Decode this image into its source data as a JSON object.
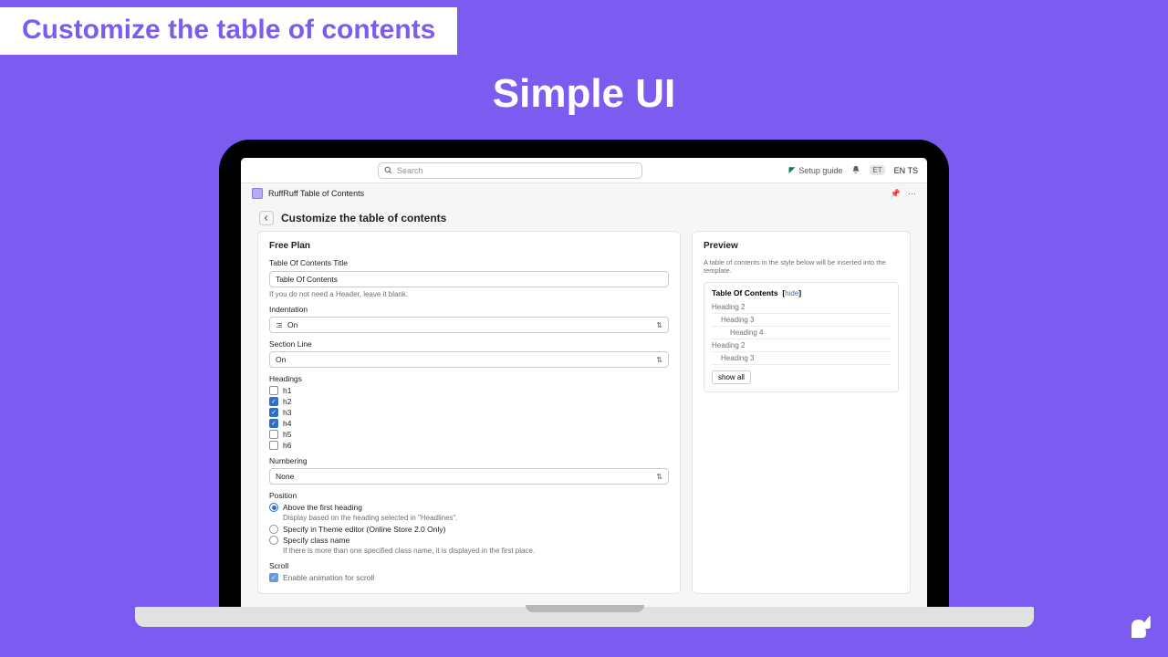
{
  "slide": {
    "banner": "Customize the table of contents",
    "title": "Simple UI"
  },
  "topbar": {
    "search_placeholder": "Search",
    "setup_guide": "Setup guide",
    "avatar_initials": "ET",
    "user_label": "EN TS"
  },
  "app": {
    "name": "RuffRuff Table of Contents",
    "pin_icon": "📌",
    "more_icon": "⋯"
  },
  "page": {
    "title": "Customize the table of contents"
  },
  "form": {
    "plan_heading": "Free Plan",
    "toc_title_label": "Table Of Contents Title",
    "toc_title_value": "Table Of Contents",
    "toc_title_help": "If you do not need a Header, leave it blank.",
    "indentation_label": "Indentation",
    "indentation_value": "On",
    "sectionline_label": "Section Line",
    "sectionline_value": "On",
    "headings_label": "Headings",
    "headings": [
      {
        "label": "h1",
        "checked": false
      },
      {
        "label": "h2",
        "checked": true
      },
      {
        "label": "h3",
        "checked": true
      },
      {
        "label": "h4",
        "checked": true
      },
      {
        "label": "h5",
        "checked": false
      },
      {
        "label": "h6",
        "checked": false
      }
    ],
    "numbering_label": "Numbering",
    "numbering_value": "None",
    "position_label": "Position",
    "position_options": [
      {
        "label": "Above the first heading",
        "checked": true,
        "help": "Display based on the heading selected in \"Headlines\"."
      },
      {
        "label": "Specify in Theme editor (Online Store 2.0 Only)",
        "checked": false
      },
      {
        "label": "Specify class name",
        "checked": false,
        "help": "If there is more than one specified class name, it is displayed in the first place."
      }
    ],
    "scroll_label": "Scroll",
    "scroll_checkbox": "Enable animation for scroll"
  },
  "preview": {
    "heading": "Preview",
    "desc": "A table of contents in the style below will be inserted into the template.",
    "toc_title": "Table Of Contents",
    "hide_label": "hide",
    "items": [
      {
        "level": "h2",
        "label": "Heading 2"
      },
      {
        "level": "h3",
        "label": "Heading 3"
      },
      {
        "level": "h4",
        "label": "Heading 4"
      },
      {
        "level": "h2",
        "label": "Heading 2"
      },
      {
        "level": "h3",
        "label": "Heading 3"
      }
    ],
    "show_all": "show all"
  }
}
